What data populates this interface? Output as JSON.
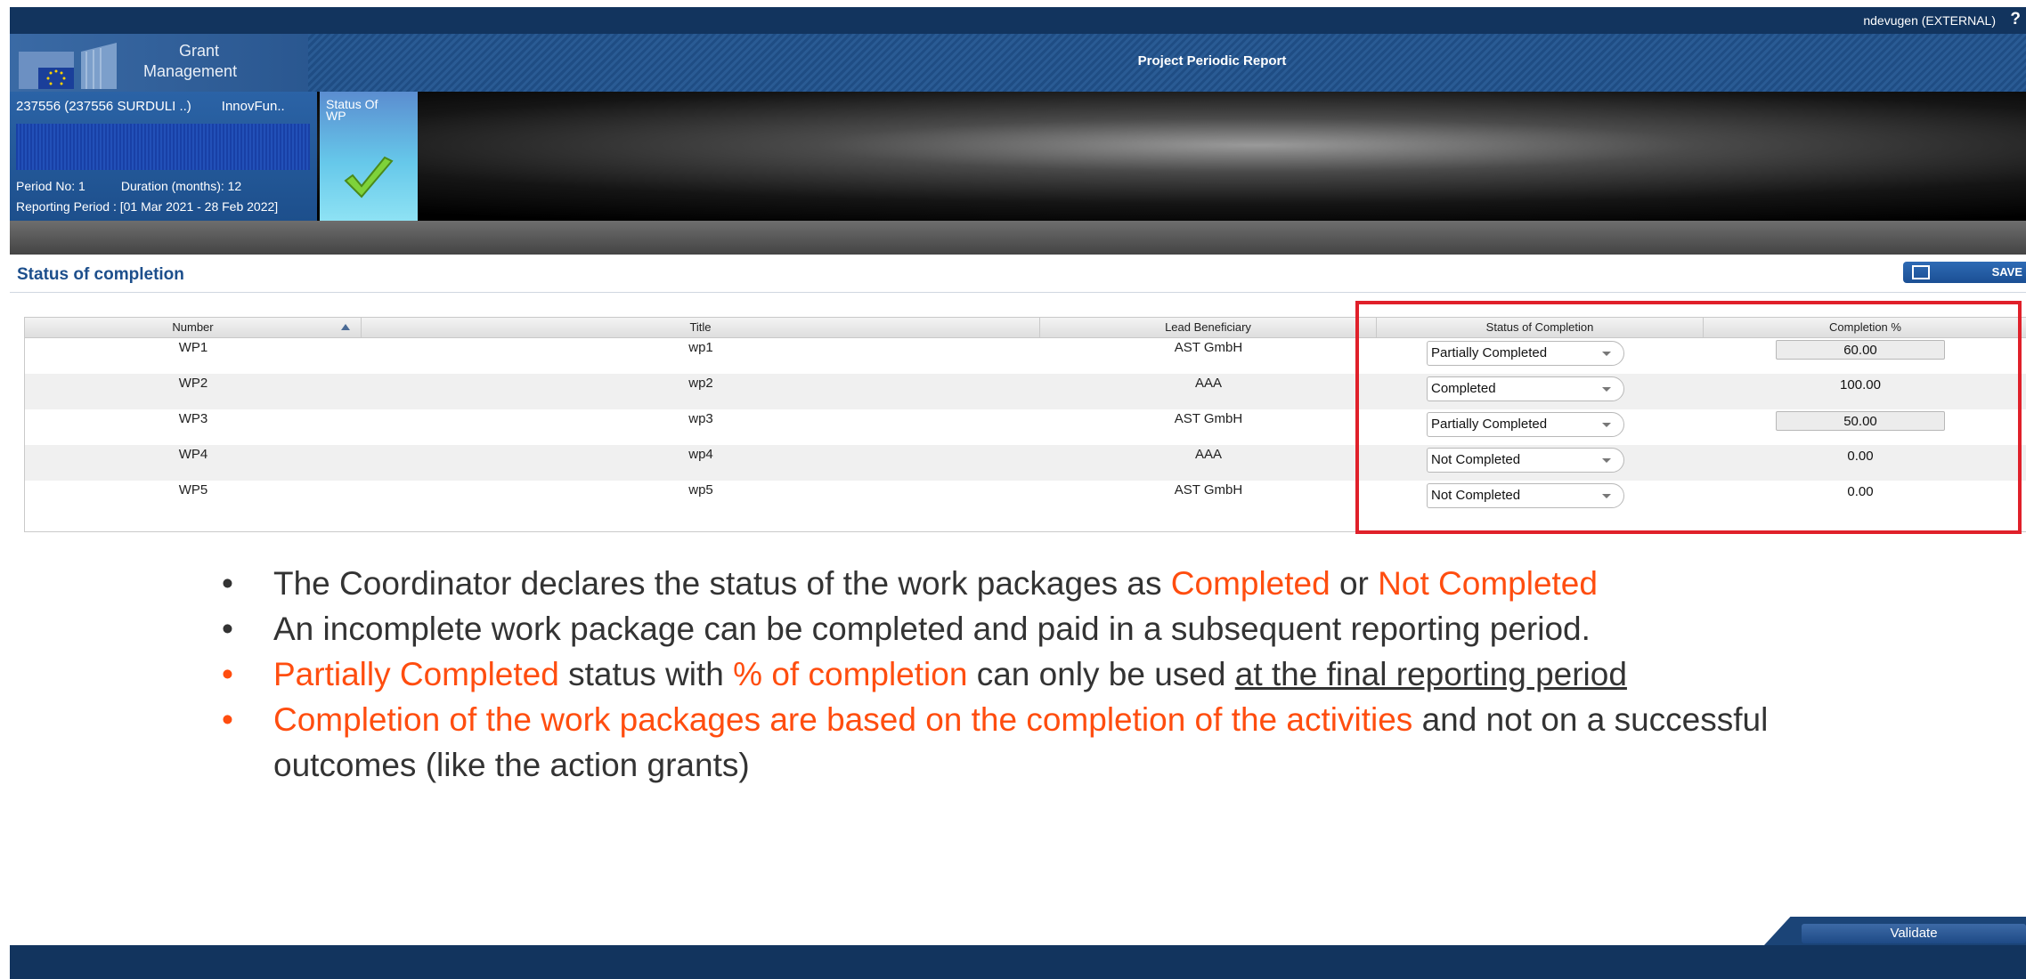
{
  "topbar": {
    "user": "ndevugen (EXTERNAL)",
    "help": "?"
  },
  "header": {
    "logo_line1": "Grant",
    "logo_line2": "Management",
    "title": "Project Periodic Report"
  },
  "project_info": {
    "id": "237556 (237556 SURDULI ..)",
    "acronym": "InnovFun..",
    "period_no": "Period No: 1",
    "duration": "Duration (months): 12",
    "reporting_period": "Reporting Period : [01 Mar 2021 - 28 Feb 2022]",
    "status_tile_label": "Status Of WP"
  },
  "section": {
    "title": "Status of completion",
    "save_label": "SAVE"
  },
  "table": {
    "headers": {
      "number": "Number",
      "title": "Title",
      "lead": "Lead Beneficiary",
      "status": "Status of Completion",
      "completion": "Completion %"
    },
    "rows": [
      {
        "number": "WP1",
        "title": "wp1",
        "lead": "AST GmbH",
        "status": "Partially Completed",
        "completion": "60.00"
      },
      {
        "number": "WP2",
        "title": "wp2",
        "lead": "AAA",
        "status": "Completed",
        "completion": "100.00"
      },
      {
        "number": "WP3",
        "title": "wp3",
        "lead": "AST GmbH",
        "status": "Partially Completed",
        "completion": "50.00"
      },
      {
        "number": "WP4",
        "title": "wp4",
        "lead": "AAA",
        "status": "Not Completed",
        "completion": "0.00"
      },
      {
        "number": "WP5",
        "title": "wp5",
        "lead": "AST GmbH",
        "status": "Not Completed",
        "completion": "0.00"
      }
    ]
  },
  "bullets": {
    "dot": "•",
    "b1_pre": "The Coordinator declares the status of the work packages as ",
    "b1_completed": "Completed",
    "b1_or": " or ",
    "b1_not_completed": "Not Completed",
    "b2": "An incomplete work package can be completed and paid in a subsequent reporting period.",
    "b3_partial": "Partially Completed",
    "b3_mid1": " status with ",
    "b3_pct": "% of completion",
    "b3_mid2": " can only be used ",
    "b3_final": "at the final reporting period",
    "b4_orange": "Completion of the work packages are based on the completion of the activities",
    "b4_rest": " and not on a successful outcomes (like the action grants)"
  },
  "footer": {
    "validate_label": "Validate"
  },
  "colors": {
    "navy": "#12345e",
    "highlight_red": "#e0202a",
    "emphasis_orange": "#ff4d0f"
  }
}
